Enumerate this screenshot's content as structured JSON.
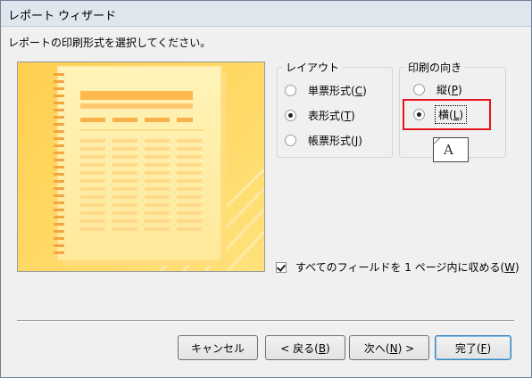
{
  "window": {
    "title": "レポート ウィザード"
  },
  "instruction": "レポートの印刷形式を選択してください。",
  "layout": {
    "legend": "レイアウト",
    "options": [
      {
        "label": "単票形式",
        "key": "C",
        "selected": false
      },
      {
        "label": "表形式",
        "key": "T",
        "selected": true
      },
      {
        "label": "帳票形式",
        "key": "J",
        "selected": false
      }
    ]
  },
  "orientation": {
    "legend": "印刷の向き",
    "options": [
      {
        "label": "縦",
        "key": "P",
        "selected": false
      },
      {
        "label": "横",
        "key": "L",
        "selected": true
      }
    ],
    "icon_letter": "A"
  },
  "fit_fields": {
    "label": "すべてのフィールドを 1 ページ内に収める",
    "key": "W",
    "checked": true
  },
  "buttons": {
    "cancel": "キャンセル",
    "back": {
      "label": "< 戻る",
      "key": "B"
    },
    "next": {
      "label": "次へ",
      "key": "N",
      "suffix": " >"
    },
    "finish": {
      "label": "完了",
      "key": "F"
    }
  },
  "colors": {
    "preview_bg": "#ffd65a",
    "page": "#fff2b3",
    "highlight_band": "#fdb84e",
    "highlight_box": "#e2141c"
  }
}
